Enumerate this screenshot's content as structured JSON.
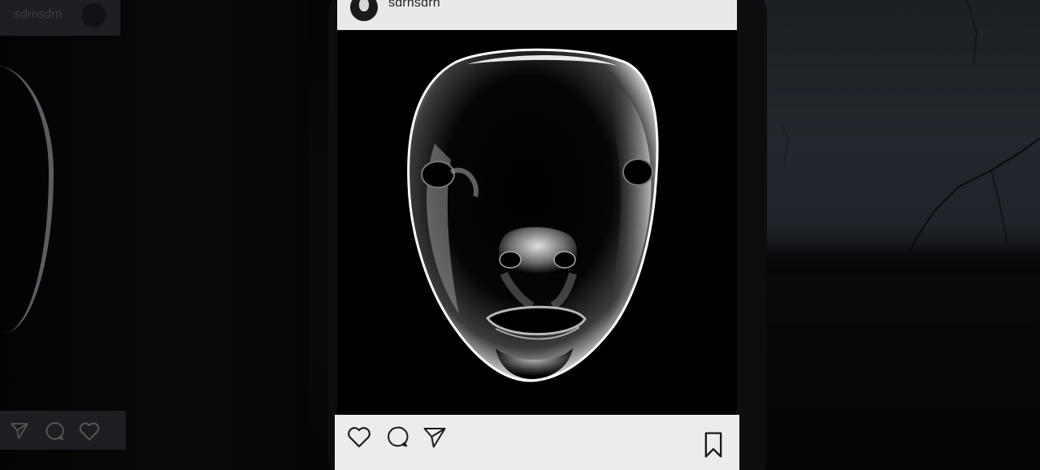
{
  "post": {
    "username": "sdrnsdrn"
  },
  "left_card": {
    "username": "sdrnsdrn"
  },
  "icons": {
    "like": "heart-icon",
    "comment": "comment-icon",
    "share": "send-icon",
    "save": "bookmark-icon"
  },
  "colors": {
    "card_bg": "#e9e9e9",
    "icon_stroke": "#1a1a1a",
    "image_bg": "#000000"
  }
}
